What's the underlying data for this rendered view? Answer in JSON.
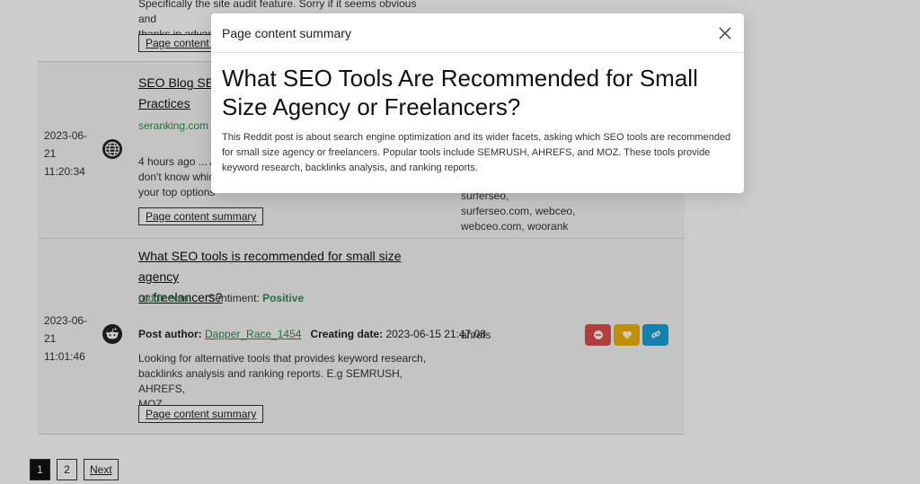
{
  "results": [
    {
      "snippet_top": "Specifically the site audit feature. Sorry if it seems obvious and",
      "snippet_bottom": "thanks in advance",
      "summary_button": "Page content summary"
    },
    {
      "title_line1": "SEO Blog SE Ranking",
      "title_line2": "Practices",
      "domain": "seranking.com",
      "date": "2023-06-",
      "date2": "21",
      "time": "11:20:34",
      "snippet": [
        "4 hours ago ... A",
        "don't know which",
        "your top options"
      ],
      "tags": [
        "surferseo,",
        "surferseo.com, webceo,",
        "webceo.com, woorank"
      ],
      "summary_button": "Page content summary"
    },
    {
      "title_line1": "What SEO tools is recommended for small size agency",
      "title_line2": "or freelancers?",
      "domain": "reddit.com",
      "sentiment_label": "Sentiment:",
      "sentiment_value": "Positive",
      "date": "2023-06-",
      "date2": "21",
      "time": "11:01:46",
      "author_label": "Post author:",
      "author": "Dapper_Race_1454",
      "creation_label": "Creating date:",
      "creation_date": "2023-06-15 21:47:08",
      "tag": "ahrefs",
      "snippet": [
        "Looking for alternative tools that provides keyword research,",
        "backlinks analysis and ranking reports. E.g SEMRUSH, AHREFS,",
        "MOZ."
      ],
      "summary_button": "Page content summary"
    }
  ],
  "pagination": {
    "pages": [
      "1",
      "2"
    ],
    "next": "Next"
  },
  "modal": {
    "title": "Page content summary",
    "heading": "What SEO Tools Are Recommended for Small Size Agency or Freelancers?",
    "body": "This Reddit post is about search engine optimization and its wider facets, asking which SEO tools are recommended for small size agency or freelancers. Popular tools include SEMRUSH, AHREFS, and MOZ. These tools provide keyword research, backlinks analysis, and ranking reports."
  },
  "colors": {
    "link_green": "#2e8b57",
    "btn_red": "#e04b4b",
    "btn_yellow": "#f0b400",
    "btn_blue": "#1aa0d8"
  },
  "icons": [
    "globe-icon",
    "reddit-icon",
    "minus-circle-icon",
    "heart-icon",
    "link-icon",
    "close-icon"
  ]
}
